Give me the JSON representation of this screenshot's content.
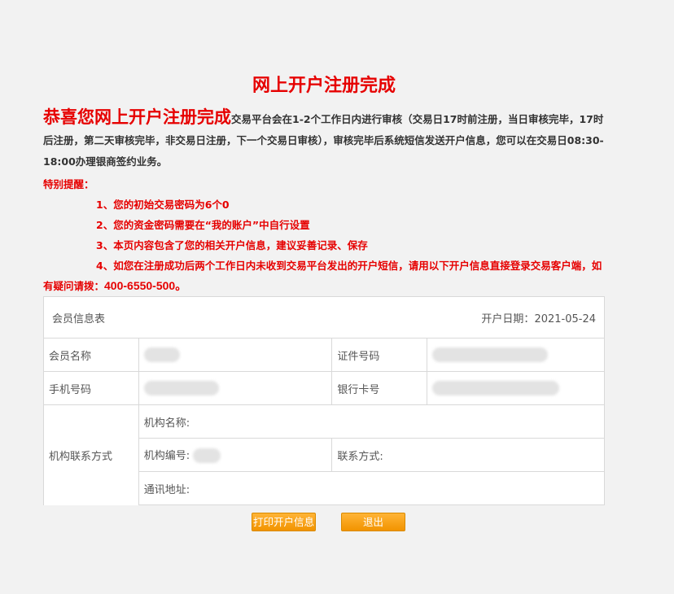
{
  "title": "网上开户注册完成",
  "intro": {
    "headline": "恭喜您网上开户注册完成",
    "text": "交易平台会在1-2个工作日内进行审核（交易日17时前注册，当日审核完毕，17时后注册，第二天审核完毕，非交易日注册，下一个交易日审核），审核完毕后系统短信发送开户信息，您可以在交易日08:30-18:00办理银商签约业务。"
  },
  "notice": {
    "heading": "特别提醒：",
    "items": [
      "1、您的初始交易密码为6个0",
      "2、您的资金密码需要在“我的账户”中自行设置",
      "3、本页内容包含了您的相关开户信息，建议妥善记录、保存",
      "4、如您在注册成功后两个工作日内未收到交易平台发出的开户短信，请用以下开户信息直接登录交易客户端，如有疑问请拨："
    ],
    "phone": "400-6550-500。"
  },
  "table": {
    "title": "会员信息表",
    "open_date_label": "开户日期：",
    "open_date": "2021-05-24",
    "member_name_label": "会员名称",
    "id_number_label": "证件号码",
    "phone_label": "手机号码",
    "bank_card_label": "银行卡号",
    "org_contact_label": "机构联系方式",
    "org_name_label": "机构名称:",
    "org_number_label": "机构编号:",
    "contact_method_label": "联系方式:",
    "address_label": "通讯地址:"
  },
  "buttons": {
    "print": "打印开户信息",
    "exit": "退出"
  },
  "colors": {
    "accent_red": "#e60000",
    "button_orange": "#f29400"
  }
}
